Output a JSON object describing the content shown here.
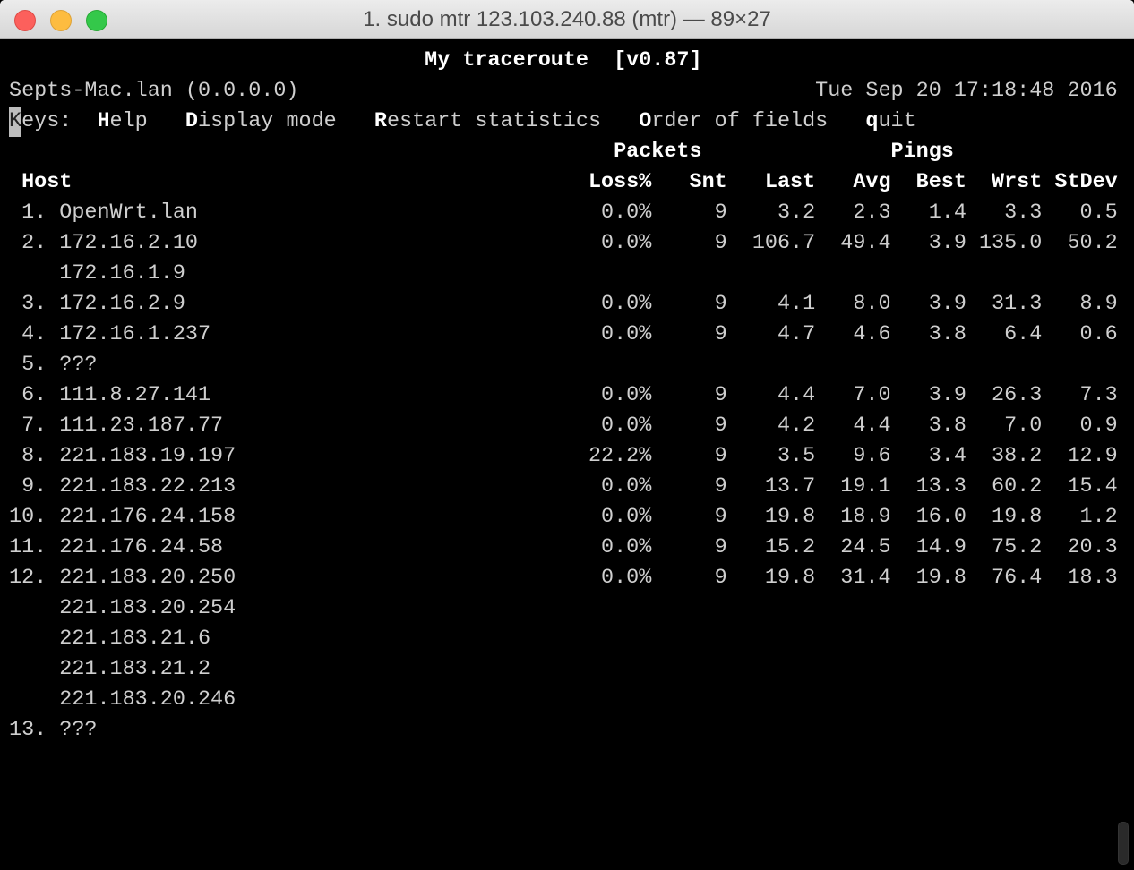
{
  "window": {
    "title": "1. sudo mtr 123.103.240.88 (mtr) — 89×27"
  },
  "header": {
    "title": "My traceroute  [v0.87]",
    "hostname": "Septs-Mac.lan (0.0.0.0)",
    "datetime": "Tue Sep 20 17:18:48 2016"
  },
  "keys": {
    "label": "Keys:",
    "items": [
      {
        "key": "H",
        "rest": "elp",
        "col": 7
      },
      {
        "key": "D",
        "rest": "isplay mode",
        "col": 14
      },
      {
        "key": "R",
        "rest": "estart statistics",
        "col": 29
      },
      {
        "key": "O",
        "rest": "rder of fields",
        "col": 50
      },
      {
        "key": "q",
        "rest": "uit",
        "col": 68
      }
    ]
  },
  "groups": {
    "packets": "Packets",
    "pings": "Pings"
  },
  "columns": {
    "host": "Host",
    "loss": "Loss%",
    "snt": "Snt",
    "last": "Last",
    "avg": "Avg",
    "best": "Best",
    "wrst": "Wrst",
    "stdev": "StDev"
  },
  "hops": [
    {
      "num": "1.",
      "host": "OpenWrt.lan",
      "loss": "0.0%",
      "snt": "9",
      "last": "3.2",
      "avg": "2.3",
      "best": "1.4",
      "wrst": "3.3",
      "stdev": "0.5"
    },
    {
      "num": "2.",
      "host": "172.16.2.10",
      "loss": "0.0%",
      "snt": "9",
      "last": "106.7",
      "avg": "49.4",
      "best": "3.9",
      "wrst": "135.0",
      "stdev": "50.2"
    },
    {
      "num": "",
      "host": "172.16.1.9"
    },
    {
      "num": "3.",
      "host": "172.16.2.9",
      "loss": "0.0%",
      "snt": "9",
      "last": "4.1",
      "avg": "8.0",
      "best": "3.9",
      "wrst": "31.3",
      "stdev": "8.9"
    },
    {
      "num": "4.",
      "host": "172.16.1.237",
      "loss": "0.0%",
      "snt": "9",
      "last": "4.7",
      "avg": "4.6",
      "best": "3.8",
      "wrst": "6.4",
      "stdev": "0.6"
    },
    {
      "num": "5.",
      "host": "???"
    },
    {
      "num": "6.",
      "host": "111.8.27.141",
      "loss": "0.0%",
      "snt": "9",
      "last": "4.4",
      "avg": "7.0",
      "best": "3.9",
      "wrst": "26.3",
      "stdev": "7.3"
    },
    {
      "num": "7.",
      "host": "111.23.187.77",
      "loss": "0.0%",
      "snt": "9",
      "last": "4.2",
      "avg": "4.4",
      "best": "3.8",
      "wrst": "7.0",
      "stdev": "0.9"
    },
    {
      "num": "8.",
      "host": "221.183.19.197",
      "loss": "22.2%",
      "snt": "9",
      "last": "3.5",
      "avg": "9.6",
      "best": "3.4",
      "wrst": "38.2",
      "stdev": "12.9"
    },
    {
      "num": "9.",
      "host": "221.183.22.213",
      "loss": "0.0%",
      "snt": "9",
      "last": "13.7",
      "avg": "19.1",
      "best": "13.3",
      "wrst": "60.2",
      "stdev": "15.4"
    },
    {
      "num": "10.",
      "host": "221.176.24.158",
      "loss": "0.0%",
      "snt": "9",
      "last": "19.8",
      "avg": "18.9",
      "best": "16.0",
      "wrst": "19.8",
      "stdev": "1.2"
    },
    {
      "num": "11.",
      "host": "221.176.24.58",
      "loss": "0.0%",
      "snt": "9",
      "last": "15.2",
      "avg": "24.5",
      "best": "14.9",
      "wrst": "75.2",
      "stdev": "20.3"
    },
    {
      "num": "12.",
      "host": "221.183.20.250",
      "loss": "0.0%",
      "snt": "9",
      "last": "19.8",
      "avg": "31.4",
      "best": "19.8",
      "wrst": "76.4",
      "stdev": "18.3"
    },
    {
      "num": "",
      "host": "221.183.20.254"
    },
    {
      "num": "",
      "host": "221.183.21.6"
    },
    {
      "num": "",
      "host": "221.183.21.2"
    },
    {
      "num": "",
      "host": "221.183.20.246"
    },
    {
      "num": "13.",
      "host": "???"
    }
  ]
}
